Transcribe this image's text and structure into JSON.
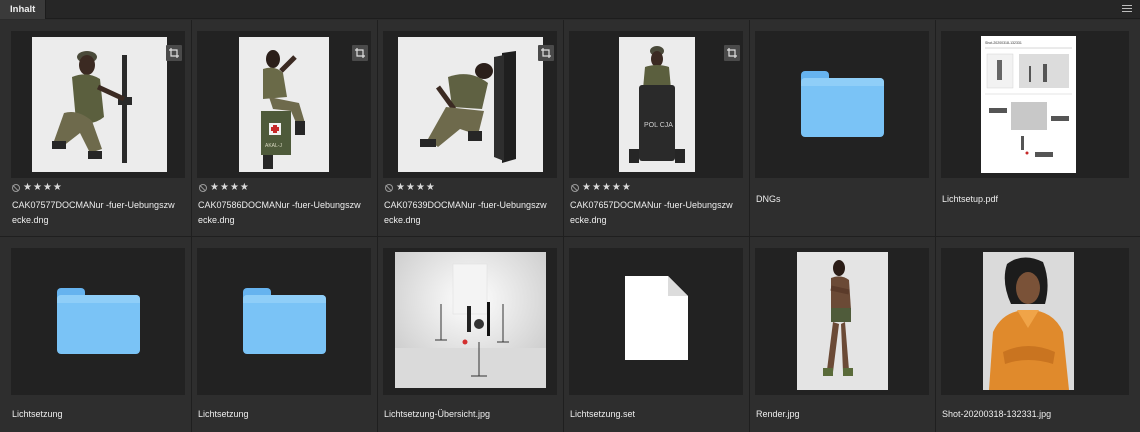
{
  "panel": {
    "tab_label": "Inhalt",
    "menu_icon": "hamburger-menu-icon"
  },
  "items": [
    {
      "name": "CAK07577DOCMANur -fuer-Uebungszwecke.dng",
      "type": "image",
      "rating": 4,
      "rejected": true,
      "edited": true
    },
    {
      "name": "CAK07586DOCMANur -fuer-Uebungszwecke.dng",
      "type": "image",
      "rating": 4,
      "rejected": true,
      "edited": true
    },
    {
      "name": "CAK07639DOCMANur -fuer-Uebungszwecke.dng",
      "type": "image",
      "rating": 4,
      "rejected": true,
      "edited": true
    },
    {
      "name": "CAK07657DOCMANur -fuer-Uebungszwecke.dng",
      "type": "image",
      "rating": 5,
      "rejected": true,
      "edited": true
    },
    {
      "name": "DNGs",
      "type": "folder"
    },
    {
      "name": "Lichtsetup.pdf",
      "type": "pdf",
      "doc_title": "Shot-20200318-132331"
    },
    {
      "name": "Lichtsetzung",
      "type": "folder"
    },
    {
      "name": "Lichtsetzung",
      "type": "folder"
    },
    {
      "name": "Lichtsetzung-Übersicht.jpg",
      "type": "image"
    },
    {
      "name": "Lichtsetzung.set",
      "type": "document"
    },
    {
      "name": "Render.jpg",
      "type": "image"
    },
    {
      "name": "Shot-20200318-132331.jpg",
      "type": "image"
    }
  ],
  "thumbnail_text": {
    "box_label": "AKAL-J",
    "shield_label": "POL CJA"
  },
  "colors": {
    "panel_bg": "#1f1f1f",
    "cell_bg": "#2e2e2e",
    "folder_blue": "#7ac3f6",
    "text": "#eeeeee"
  }
}
